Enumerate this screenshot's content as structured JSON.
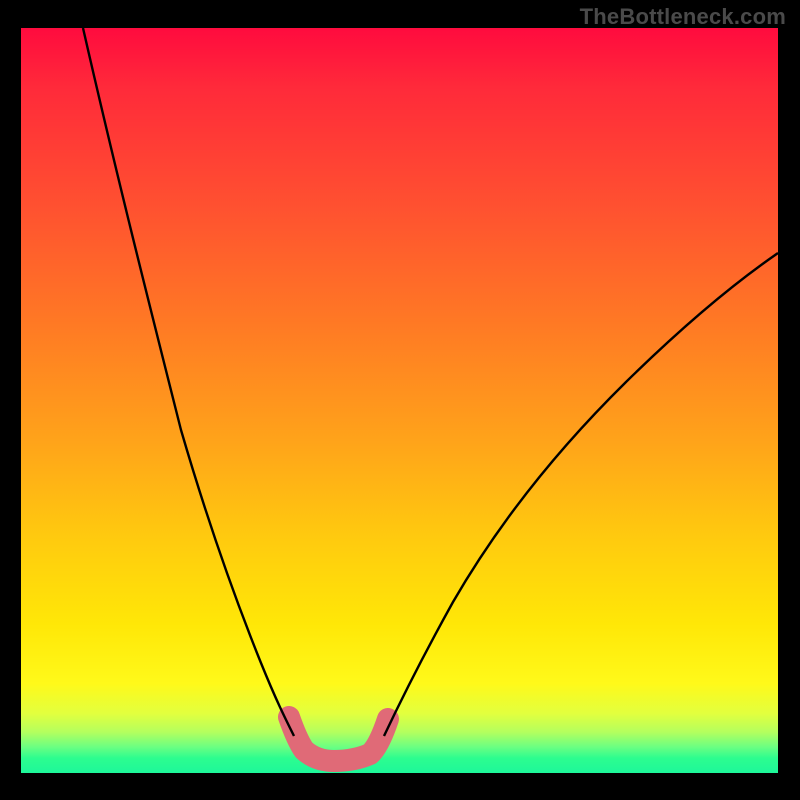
{
  "watermark": "TheBottleneck.com",
  "chart_data": {
    "type": "line",
    "title": "",
    "xlabel": "",
    "ylabel": "",
    "xlim": [
      0,
      100
    ],
    "ylim": [
      0,
      100
    ],
    "gradient_stops": [
      {
        "pos": 0,
        "color": "#ff0b3e"
      },
      {
        "pos": 8,
        "color": "#ff2a3a"
      },
      {
        "pos": 24,
        "color": "#ff5130"
      },
      {
        "pos": 40,
        "color": "#ff7a24"
      },
      {
        "pos": 55,
        "color": "#ffa21a"
      },
      {
        "pos": 68,
        "color": "#ffc90f"
      },
      {
        "pos": 80,
        "color": "#ffe707"
      },
      {
        "pos": 88,
        "color": "#fff91a"
      },
      {
        "pos": 92,
        "color": "#e2ff3e"
      },
      {
        "pos": 94.5,
        "color": "#b4ff5e"
      },
      {
        "pos": 96.5,
        "color": "#6bff82"
      },
      {
        "pos": 98,
        "color": "#2dfd8f"
      },
      {
        "pos": 100,
        "color": "#1df79a"
      }
    ],
    "series": [
      {
        "name": "curve-left",
        "x": [
          8,
          12,
          16,
          20,
          24,
          28,
          30,
          32,
          34,
          36
        ],
        "y": [
          100,
          80,
          62,
          46,
          33,
          22,
          17,
          12,
          8,
          5
        ],
        "stroke": "#000000",
        "stroke_width": 2
      },
      {
        "name": "curve-right",
        "x": [
          48,
          51,
          55,
          60,
          66,
          73,
          81,
          90,
          100
        ],
        "y": [
          5,
          9,
          15,
          22,
          30,
          38,
          47,
          55,
          63
        ],
        "stroke": "#000000",
        "stroke_width": 2
      },
      {
        "name": "trough-highlight",
        "x": [
          35.5,
          37,
          38.5,
          40.5,
          43,
          45.5,
          47,
          48.5
        ],
        "y": [
          7.5,
          4,
          2.2,
          1.7,
          1.8,
          2.6,
          4.2,
          7.2
        ],
        "stroke": "#e06a77",
        "stroke_width": 12,
        "linecap": "round"
      }
    ],
    "note": "x and y in percent of plot area; y=0 at bottom, y=100 at top. Values estimated from pixels."
  }
}
